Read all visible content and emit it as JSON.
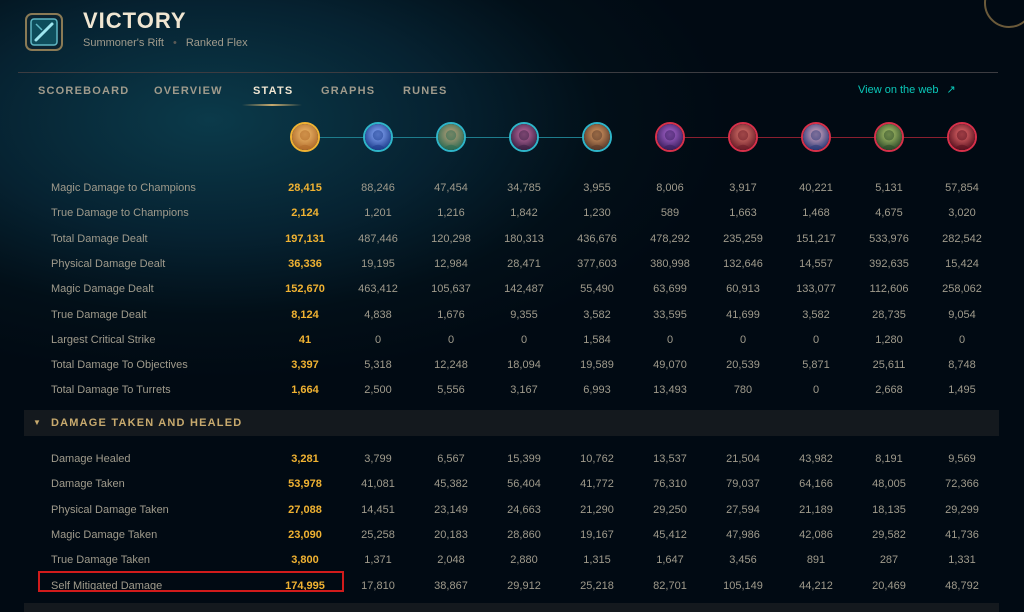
{
  "header": {
    "title": "VICTORY",
    "map": "Summoner's Rift",
    "separator": "•",
    "queue": "Ranked Flex"
  },
  "tabs": [
    "SCOREBOARD",
    "OVERVIEW",
    "STATS",
    "GRAPHS",
    "RUNES"
  ],
  "active_tab": "STATS",
  "web_link": {
    "label": "View on the web",
    "icon": "external-arrow-icon",
    "arrow": "↗"
  },
  "colors": {
    "self_gold": "#f0b232",
    "blue_team": "#2fb5c9",
    "red_team": "#d8304a",
    "accent_gold": "#c8aa6e",
    "link_teal": "#0ac8b9"
  },
  "champions": [
    {
      "team": "self",
      "icon": "champion-portrait-icon"
    },
    {
      "team": "blue",
      "icon": "champion-portrait-icon"
    },
    {
      "team": "blue",
      "icon": "champion-portrait-icon"
    },
    {
      "team": "blue",
      "icon": "champion-portrait-icon"
    },
    {
      "team": "blue",
      "icon": "champion-portrait-icon"
    },
    {
      "team": "red",
      "icon": "champion-portrait-icon"
    },
    {
      "team": "red",
      "icon": "champion-portrait-icon"
    },
    {
      "team": "red",
      "icon": "champion-portrait-icon"
    },
    {
      "team": "red",
      "icon": "champion-portrait-icon"
    },
    {
      "team": "red",
      "icon": "champion-portrait-icon"
    }
  ],
  "damage_rows": [
    {
      "label": "Magic Damage to Champions",
      "values": [
        "28,415",
        "88,246",
        "47,454",
        "34,785",
        "3,955",
        "8,006",
        "3,917",
        "40,221",
        "5,131",
        "57,854"
      ]
    },
    {
      "label": "True Damage to Champions",
      "values": [
        "2,124",
        "1,201",
        "1,216",
        "1,842",
        "1,230",
        "589",
        "1,663",
        "1,468",
        "4,675",
        "3,020"
      ]
    },
    {
      "label": "Total Damage Dealt",
      "values": [
        "197,131",
        "487,446",
        "120,298",
        "180,313",
        "436,676",
        "478,292",
        "235,259",
        "151,217",
        "533,976",
        "282,542"
      ]
    },
    {
      "label": "Physical Damage Dealt",
      "values": [
        "36,336",
        "19,195",
        "12,984",
        "28,471",
        "377,603",
        "380,998",
        "132,646",
        "14,557",
        "392,635",
        "15,424"
      ]
    },
    {
      "label": "Magic Damage Dealt",
      "values": [
        "152,670",
        "463,412",
        "105,637",
        "142,487",
        "55,490",
        "63,699",
        "60,913",
        "133,077",
        "112,606",
        "258,062"
      ]
    },
    {
      "label": "True Damage Dealt",
      "values": [
        "8,124",
        "4,838",
        "1,676",
        "9,355",
        "3,582",
        "33,595",
        "41,699",
        "3,582",
        "28,735",
        "9,054"
      ]
    },
    {
      "label": "Largest Critical Strike",
      "values": [
        "41",
        "0",
        "0",
        "0",
        "1,584",
        "0",
        "0",
        "0",
        "1,280",
        "0"
      ]
    },
    {
      "label": "Total Damage To Objectives",
      "values": [
        "3,397",
        "5,318",
        "12,248",
        "18,094",
        "19,589",
        "49,070",
        "20,539",
        "5,871",
        "25,611",
        "8,748"
      ]
    },
    {
      "label": "Total Damage To Turrets",
      "values": [
        "1,664",
        "2,500",
        "5,556",
        "3,167",
        "6,993",
        "13,493",
        "780",
        "0",
        "2,668",
        "1,495"
      ]
    }
  ],
  "section": {
    "title": "DAMAGE TAKEN AND HEALED",
    "icon": "chevron-down-icon",
    "chevron": "▼"
  },
  "taken_rows": [
    {
      "label": "Damage Healed",
      "values": [
        "3,281",
        "3,799",
        "6,567",
        "15,399",
        "10,762",
        "13,537",
        "21,504",
        "43,982",
        "8,191",
        "9,569"
      ]
    },
    {
      "label": "Damage Taken",
      "values": [
        "53,978",
        "41,081",
        "45,382",
        "56,404",
        "41,772",
        "76,310",
        "79,037",
        "64,166",
        "48,005",
        "72,366"
      ]
    },
    {
      "label": "Physical Damage Taken",
      "values": [
        "27,088",
        "14,451",
        "23,149",
        "24,663",
        "21,290",
        "29,250",
        "27,594",
        "21,189",
        "18,135",
        "29,299"
      ]
    },
    {
      "label": "Magic Damage Taken",
      "values": [
        "23,090",
        "25,258",
        "20,183",
        "28,860",
        "19,167",
        "45,412",
        "47,986",
        "42,086",
        "29,582",
        "41,736"
      ]
    },
    {
      "label": "True Damage Taken",
      "values": [
        "3,800",
        "1,371",
        "2,048",
        "2,880",
        "1,315",
        "1,647",
        "3,456",
        "891",
        "287",
        "1,331"
      ]
    },
    {
      "label": "Self Mitigated Damage",
      "values": [
        "174,995",
        "17,810",
        "38,867",
        "29,912",
        "25,218",
        "82,701",
        "105,149",
        "44,212",
        "20,469",
        "48,792"
      ]
    }
  ]
}
